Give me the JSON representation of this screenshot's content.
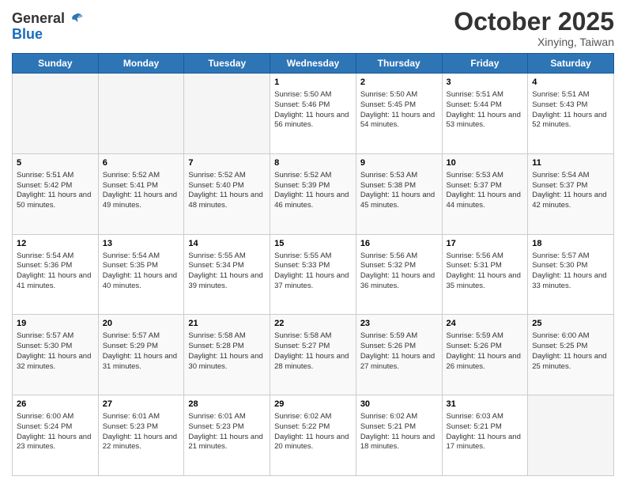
{
  "header": {
    "logo_line1": "General",
    "logo_line2": "Blue",
    "month": "October 2025",
    "location": "Xinying, Taiwan"
  },
  "days_of_week": [
    "Sunday",
    "Monday",
    "Tuesday",
    "Wednesday",
    "Thursday",
    "Friday",
    "Saturday"
  ],
  "weeks": [
    [
      {
        "day": "",
        "text": ""
      },
      {
        "day": "",
        "text": ""
      },
      {
        "day": "",
        "text": ""
      },
      {
        "day": "1",
        "text": "Sunrise: 5:50 AM\nSunset: 5:46 PM\nDaylight: 11 hours and 56 minutes."
      },
      {
        "day": "2",
        "text": "Sunrise: 5:50 AM\nSunset: 5:45 PM\nDaylight: 11 hours and 54 minutes."
      },
      {
        "day": "3",
        "text": "Sunrise: 5:51 AM\nSunset: 5:44 PM\nDaylight: 11 hours and 53 minutes."
      },
      {
        "day": "4",
        "text": "Sunrise: 5:51 AM\nSunset: 5:43 PM\nDaylight: 11 hours and 52 minutes."
      }
    ],
    [
      {
        "day": "5",
        "text": "Sunrise: 5:51 AM\nSunset: 5:42 PM\nDaylight: 11 hours and 50 minutes."
      },
      {
        "day": "6",
        "text": "Sunrise: 5:52 AM\nSunset: 5:41 PM\nDaylight: 11 hours and 49 minutes."
      },
      {
        "day": "7",
        "text": "Sunrise: 5:52 AM\nSunset: 5:40 PM\nDaylight: 11 hours and 48 minutes."
      },
      {
        "day": "8",
        "text": "Sunrise: 5:52 AM\nSunset: 5:39 PM\nDaylight: 11 hours and 46 minutes."
      },
      {
        "day": "9",
        "text": "Sunrise: 5:53 AM\nSunset: 5:38 PM\nDaylight: 11 hours and 45 minutes."
      },
      {
        "day": "10",
        "text": "Sunrise: 5:53 AM\nSunset: 5:37 PM\nDaylight: 11 hours and 44 minutes."
      },
      {
        "day": "11",
        "text": "Sunrise: 5:54 AM\nSunset: 5:37 PM\nDaylight: 11 hours and 42 minutes."
      }
    ],
    [
      {
        "day": "12",
        "text": "Sunrise: 5:54 AM\nSunset: 5:36 PM\nDaylight: 11 hours and 41 minutes."
      },
      {
        "day": "13",
        "text": "Sunrise: 5:54 AM\nSunset: 5:35 PM\nDaylight: 11 hours and 40 minutes."
      },
      {
        "day": "14",
        "text": "Sunrise: 5:55 AM\nSunset: 5:34 PM\nDaylight: 11 hours and 39 minutes."
      },
      {
        "day": "15",
        "text": "Sunrise: 5:55 AM\nSunset: 5:33 PM\nDaylight: 11 hours and 37 minutes."
      },
      {
        "day": "16",
        "text": "Sunrise: 5:56 AM\nSunset: 5:32 PM\nDaylight: 11 hours and 36 minutes."
      },
      {
        "day": "17",
        "text": "Sunrise: 5:56 AM\nSunset: 5:31 PM\nDaylight: 11 hours and 35 minutes."
      },
      {
        "day": "18",
        "text": "Sunrise: 5:57 AM\nSunset: 5:30 PM\nDaylight: 11 hours and 33 minutes."
      }
    ],
    [
      {
        "day": "19",
        "text": "Sunrise: 5:57 AM\nSunset: 5:30 PM\nDaylight: 11 hours and 32 minutes."
      },
      {
        "day": "20",
        "text": "Sunrise: 5:57 AM\nSunset: 5:29 PM\nDaylight: 11 hours and 31 minutes."
      },
      {
        "day": "21",
        "text": "Sunrise: 5:58 AM\nSunset: 5:28 PM\nDaylight: 11 hours and 30 minutes."
      },
      {
        "day": "22",
        "text": "Sunrise: 5:58 AM\nSunset: 5:27 PM\nDaylight: 11 hours and 28 minutes."
      },
      {
        "day": "23",
        "text": "Sunrise: 5:59 AM\nSunset: 5:26 PM\nDaylight: 11 hours and 27 minutes."
      },
      {
        "day": "24",
        "text": "Sunrise: 5:59 AM\nSunset: 5:26 PM\nDaylight: 11 hours and 26 minutes."
      },
      {
        "day": "25",
        "text": "Sunrise: 6:00 AM\nSunset: 5:25 PM\nDaylight: 11 hours and 25 minutes."
      }
    ],
    [
      {
        "day": "26",
        "text": "Sunrise: 6:00 AM\nSunset: 5:24 PM\nDaylight: 11 hours and 23 minutes."
      },
      {
        "day": "27",
        "text": "Sunrise: 6:01 AM\nSunset: 5:23 PM\nDaylight: 11 hours and 22 minutes."
      },
      {
        "day": "28",
        "text": "Sunrise: 6:01 AM\nSunset: 5:23 PM\nDaylight: 11 hours and 21 minutes."
      },
      {
        "day": "29",
        "text": "Sunrise: 6:02 AM\nSunset: 5:22 PM\nDaylight: 11 hours and 20 minutes."
      },
      {
        "day": "30",
        "text": "Sunrise: 6:02 AM\nSunset: 5:21 PM\nDaylight: 11 hours and 18 minutes."
      },
      {
        "day": "31",
        "text": "Sunrise: 6:03 AM\nSunset: 5:21 PM\nDaylight: 11 hours and 17 minutes."
      },
      {
        "day": "",
        "text": ""
      }
    ]
  ]
}
